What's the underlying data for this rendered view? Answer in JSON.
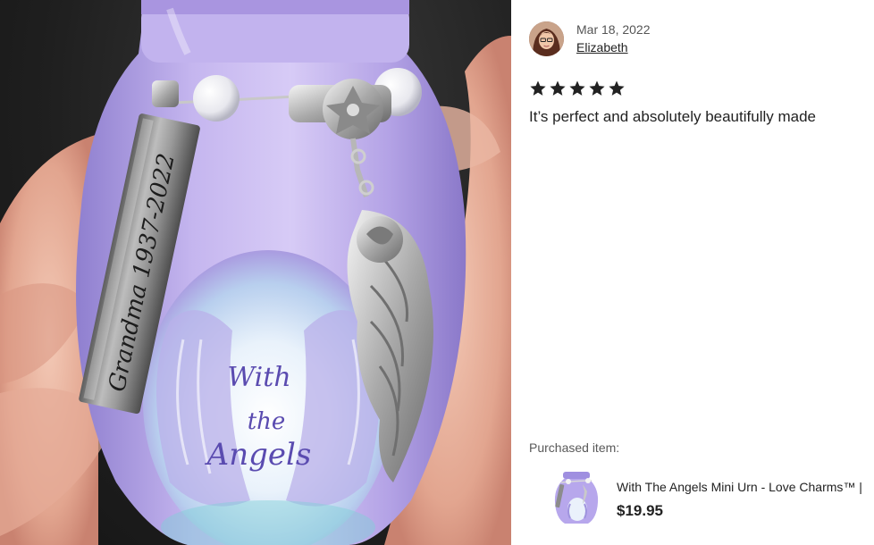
{
  "review": {
    "date": "Mar 18, 2022",
    "reviewer_name": "Elizabeth",
    "rating": 5,
    "rating_max": 5,
    "text": "It’s perfect and absolutely beautifully made"
  },
  "purchased": {
    "label": "Purchased item:",
    "title": "With The Angels Mini Urn - Love Charms™ |",
    "price": "$19.95"
  },
  "photo": {
    "tag_text": "Grandma 1937-2022",
    "urn_text_line1": "With",
    "urn_text_line2": "the",
    "urn_text_line3": "Angels"
  },
  "colors": {
    "star": "#222222",
    "urn_lavender": "#b9a8e6",
    "text_primary": "#222222",
    "text_secondary": "#595959"
  },
  "icons": {
    "star": "star-icon"
  }
}
